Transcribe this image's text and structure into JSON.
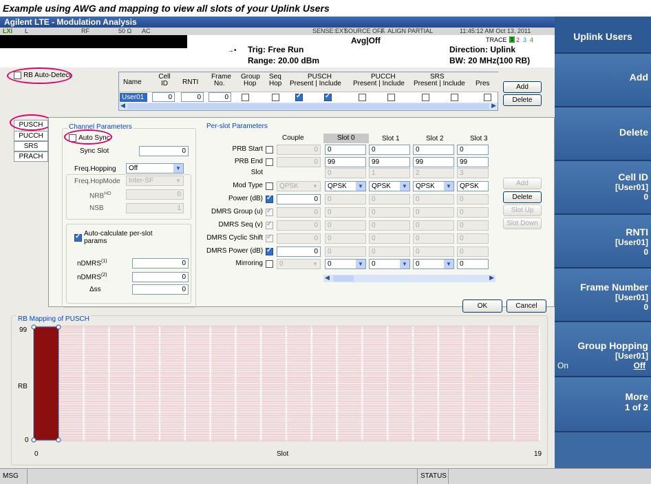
{
  "caption": "Example using AWG and mapping to view all slots of your Uplink Users",
  "app": {
    "title": "Agilent LTE - Modulation Analysis"
  },
  "status": {
    "indicator": "LXI",
    "l": "L",
    "rf": "RF",
    "ohm": "50 Ω",
    "ac": "AC",
    "sense": "SENSE:EXT",
    "source": "SOURCE OFF",
    "align": "ALIGN PARTIAL",
    "time": "11:45:12 AM Oct 13, 2011",
    "trace_label": "TRACE",
    "trace_nums": [
      "1",
      "2",
      "3",
      "4"
    ]
  },
  "meas": {
    "avg": "Avg|Off",
    "trig": "Trig: Free Run",
    "range": "Range: 20.00 dBm",
    "direction": "Direction: Uplink",
    "bw": "BW: 20 MHz(100 RB)"
  },
  "rb_auto": "RB Auto-Detect",
  "users_table": {
    "headers": [
      {
        "l1": "Name",
        "l2": ""
      },
      {
        "l1": "Cell",
        "l2": "ID"
      },
      {
        "l1": "RNTI",
        "l2": ""
      },
      {
        "l1": "Frame",
        "l2": "No."
      },
      {
        "l1": "Group",
        "l2": "Hop"
      },
      {
        "l1": "Seq",
        "l2": "Hop"
      },
      {
        "l1": "PUSCH",
        "l2": "Present | Include"
      },
      {
        "l1": "PUCCH",
        "l2": "Present | Include"
      },
      {
        "l1": "SRS",
        "l2": "Present | Include"
      },
      {
        "l1": "Pres",
        "l2": ""
      }
    ],
    "row": {
      "name": "User01",
      "cell_id": "0",
      "rnti": "0",
      "frame": "0"
    },
    "add": "Add",
    "delete": "Delete"
  },
  "tabs": [
    "PUSCH",
    "PUCCH",
    "SRS",
    "PRACH"
  ],
  "channel": {
    "title": "Channel Parameters",
    "auto_sync": "Auto Sync",
    "sync_slot_label": "Sync Slot",
    "sync_slot": "0",
    "freq_hop_label": "Freq.Hopping",
    "freq_hop": "Off",
    "hop_mode_label": "Freq.HopMode",
    "hop_mode": "Inter-SF",
    "nrb_label": "NRB",
    "nrb_sup": "HO",
    "nrb": "0",
    "nsb_label": "NSB",
    "nsb": "1",
    "autocalc": "Auto-calculate per-slot params",
    "ndmrs1_label": "nDMRS",
    "ndmrs1_sup": "(1)",
    "ndmrs1": "0",
    "ndmrs2_label": "nDMRS",
    "ndmrs2_sup": "(2)",
    "ndmrs2": "0",
    "dss_label": "Δss",
    "dss": "0"
  },
  "perslot": {
    "title": "Per-slot Parameters",
    "couple": "Couple",
    "slots": [
      "Slot 0",
      "Slot 1",
      "Slot 2",
      "Slot 3"
    ],
    "rows": [
      {
        "label": "PRB Start",
        "couple": "0",
        "vals": [
          "0",
          "0",
          "0",
          "0"
        ]
      },
      {
        "label": "PRB End",
        "couple": "0",
        "vals": [
          "99",
          "99",
          "99",
          "99"
        ]
      },
      {
        "label": "Slot",
        "couple": "",
        "vals": [
          "0",
          "1",
          "2",
          "3"
        ]
      },
      {
        "label": "Mod Type",
        "couple": "QPSK",
        "vals": [
          "QPSK",
          "QPSK",
          "QPSK",
          "QPSK"
        ]
      },
      {
        "label": "Power (dB)",
        "couple": "0",
        "vals": [
          "0",
          "0",
          "0",
          "0"
        ]
      },
      {
        "label": "DMRS Group (u)",
        "couple": "0",
        "vals": [
          "0",
          "0",
          "0",
          "0"
        ]
      },
      {
        "label": "DMRS Seq (v)",
        "couple": "0",
        "vals": [
          "0",
          "0",
          "0",
          "0"
        ]
      },
      {
        "label": "DMRS Cyclic Shift",
        "couple": "0",
        "vals": [
          "0",
          "0",
          "0",
          "0"
        ]
      },
      {
        "label": "DMRS Power (dB)",
        "couple": "0",
        "vals": [
          "0",
          "0",
          "0",
          "0"
        ]
      },
      {
        "label": "Mirroring",
        "couple": "0",
        "vals": [
          "0",
          "0",
          "0",
          "0"
        ]
      }
    ],
    "side_buttons": [
      "Add",
      "Delete",
      "Slot Up",
      "Slot Down"
    ]
  },
  "dialog": {
    "ok": "OK",
    "cancel": "Cancel"
  },
  "chart": {
    "title": "RB Mapping of PUSCH",
    "y_label": "RB",
    "x_label": "Slot",
    "y_max": "99",
    "y_min": "0",
    "x_min": "0",
    "x_max": "19"
  },
  "softkeys": [
    {
      "main": "Uplink Users",
      "sub": "",
      "val": ""
    },
    {
      "main": "Add",
      "sub": "",
      "val": ""
    },
    {
      "main": "Delete",
      "sub": "",
      "val": ""
    },
    {
      "main": "Cell ID",
      "sub": "[User01]",
      "val": "0"
    },
    {
      "main": "RNTI",
      "sub": "[User01]",
      "val": "0"
    },
    {
      "main": "Frame Number",
      "sub": "[User01]",
      "val": "0"
    },
    {
      "main": "Group Hopping",
      "sub": "[User01]",
      "on": "On",
      "off": "Off"
    },
    {
      "main": "More",
      "sub": "1 of 2",
      "val": ""
    }
  ],
  "bottom": {
    "msg": "MSG",
    "status": "STATUS"
  },
  "colors": {
    "rb_fill": "#8b0f0f",
    "grid_line": "#e8a0a0",
    "softkey_bg": "#3d6aa3"
  }
}
